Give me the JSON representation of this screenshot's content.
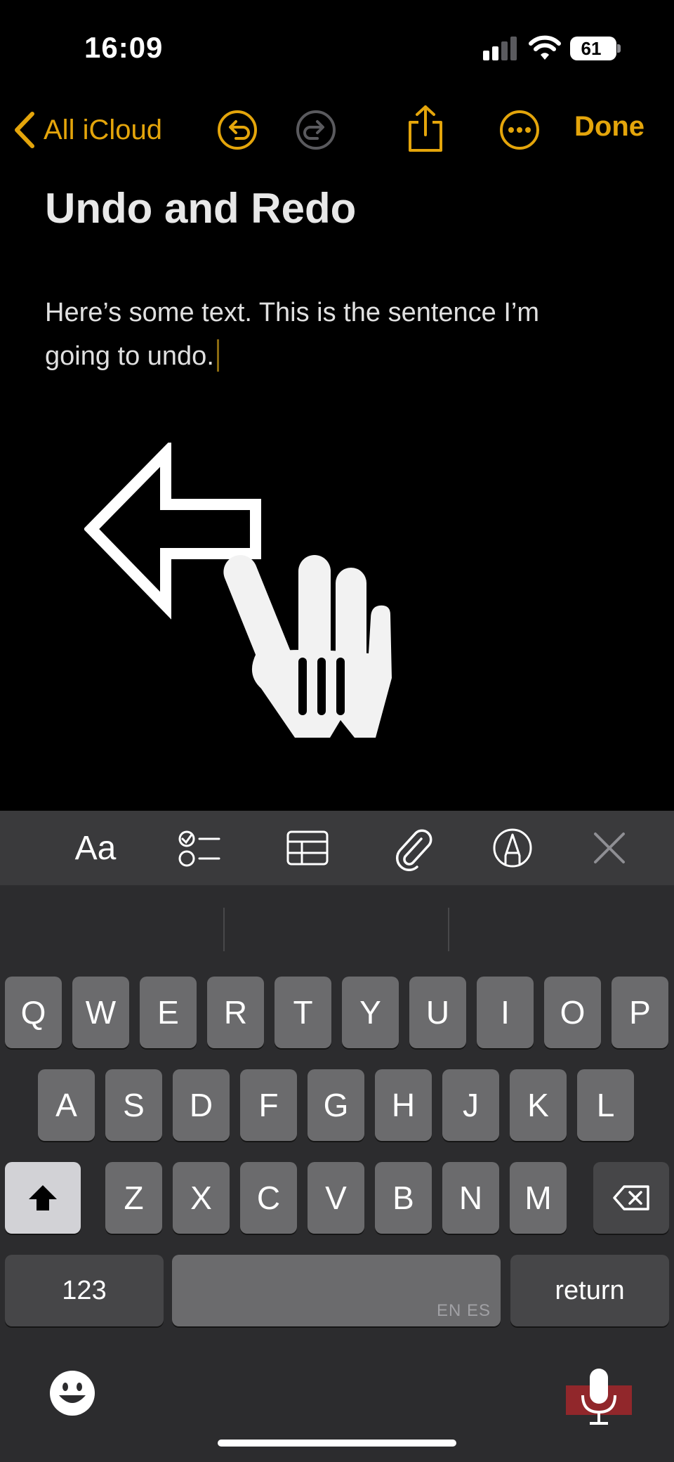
{
  "status_bar": {
    "time": "16:09",
    "battery_level": "61",
    "signal_bars_filled": 2,
    "signal_bars_total": 4
  },
  "nav": {
    "back_label": "All iCloud",
    "done_label": "Done",
    "accent_color": "#e4a50b",
    "icons": [
      "chevron-left-icon",
      "undo-icon",
      "redo-icon",
      "share-icon",
      "more-icon"
    ]
  },
  "note": {
    "title": "Undo and Redo",
    "body": "Here’s some text. This is the sentence I’m going to undo."
  },
  "gesture_overlay": {
    "icons": [
      "left-arrow-icon",
      "three-finger-hand-icon"
    ]
  },
  "toolbar": {
    "format_label": "Aa",
    "icons": [
      "checklist-icon",
      "table-icon",
      "paperclip-icon",
      "markup-pen-icon",
      "close-icon"
    ]
  },
  "keyboard": {
    "row1": [
      "Q",
      "W",
      "E",
      "R",
      "T",
      "Y",
      "U",
      "I",
      "O",
      "P"
    ],
    "row2": [
      "A",
      "S",
      "D",
      "F",
      "G",
      "H",
      "J",
      "K",
      "L"
    ],
    "row3": [
      "Z",
      "X",
      "C",
      "V",
      "B",
      "N",
      "M"
    ],
    "numbers_label": "123",
    "space_lang_hint": "EN ES",
    "return_label": "return",
    "icons": [
      "shift-icon",
      "delete-icon",
      "emoji-icon",
      "microphone-icon"
    ]
  }
}
